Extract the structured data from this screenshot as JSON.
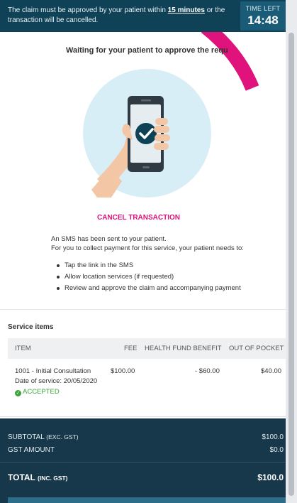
{
  "banner": {
    "message_prefix": "The claim must be approved by your patient within",
    "message_highlight": "15 minutes",
    "message_suffix": "or the transaction will be cancelled.",
    "timer_label": "TIME LEFT",
    "timer_value": "14:48"
  },
  "waiting_text": "Waiting for your patient to approve the requ",
  "illustration": {
    "icon": "phone-check-icon",
    "colors": {
      "circle": "#d8eef7",
      "accent": "#0f4257",
      "pink": "#e0127b"
    }
  },
  "cancel_label": "CANCEL TRANSACTION",
  "sms": {
    "line1": "An SMS has been sent to your patient.",
    "line2": "For you to collect payment for this service, your patient needs to:",
    "steps": [
      "Tap the link in the SMS",
      "Allow location services (if requested)",
      "Review and approve the claim and accompanying payment"
    ]
  },
  "service_items": {
    "title": "Service items",
    "columns": [
      "ITEM",
      "FEE",
      "HEALTH FUND BENEFIT",
      "OUT OF POCKET"
    ],
    "rows": [
      {
        "item": "1001 - Initial Consultation",
        "date_label": "Date of service:",
        "date_value": "20/05/2020",
        "status": "ACCEPTED",
        "fee": "$100.00",
        "benefit": "- $60.00",
        "out_of_pocket": "$40.00"
      }
    ]
  },
  "totals": {
    "subtotal_label": "SUBTOTAL",
    "subtotal_note": "(EXC. GST)",
    "subtotal_value": "$100.0",
    "gst_label": "GST AMOUNT",
    "gst_value": "$0.0",
    "total_label": "TOTAL",
    "total_note": "(INC. GST)",
    "total_value": "$100.0"
  }
}
